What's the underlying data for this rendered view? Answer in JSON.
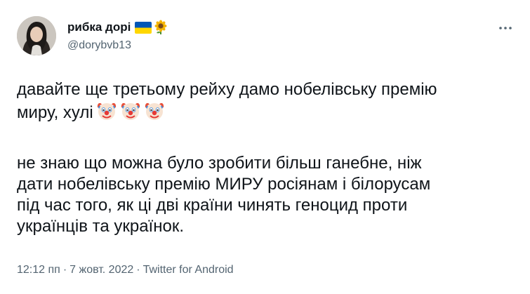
{
  "tweet": {
    "author": {
      "display_name": "рибка дорі",
      "handle": "@dorybvb13",
      "name_emojis": [
        "ukraine-flag-icon",
        "sunflower-icon"
      ]
    },
    "more_icon": "more-options-icon",
    "text": {
      "paragraph1": {
        "line1": "давайте ще третьому рейху дамо нобелівську премію",
        "line2": "миру, хулі",
        "emojis": [
          "clown-face-icon",
          "clown-face-icon",
          "clown-face-icon"
        ]
      },
      "paragraph2": {
        "lines": [
          "не знаю що можна було зробити більш ганебне, ніж",
          "дати нобелівську премію МИРУ росіянам і білорусам",
          "під час того, як ці дві країни чинять геноцид проти",
          "українців та українок."
        ]
      }
    },
    "meta": {
      "time": "12:12 пп",
      "separator": "·",
      "date": "7 жовт. 2022",
      "source": "Twitter for Android"
    },
    "colors": {
      "text": "#0f1419",
      "secondary": "#536471",
      "flag_blue": "#0057b7",
      "flag_yellow": "#ffd700"
    }
  }
}
